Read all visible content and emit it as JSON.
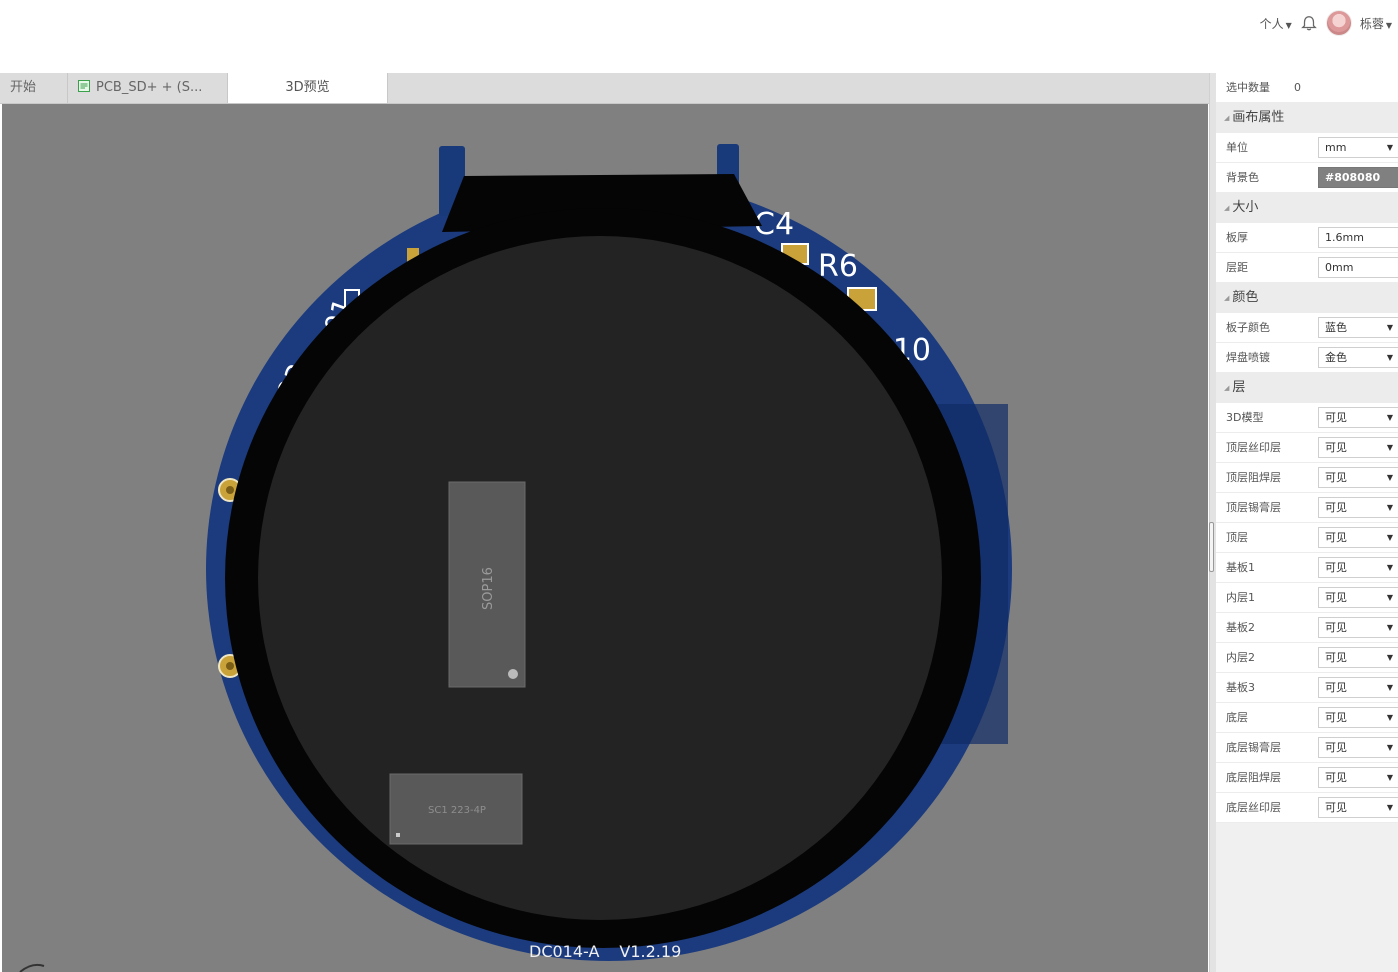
{
  "header": {
    "personal_label": "个人",
    "user_name": "栎蓉"
  },
  "tabs": [
    {
      "label": "开始"
    },
    {
      "label": "PCB_SD+ + (S..."
    },
    {
      "label": "3D预览"
    }
  ],
  "panel": {
    "selected_count_label": "选中数量",
    "selected_count": "0",
    "sections": {
      "canvas": "画布属性",
      "size": "大小",
      "color": "颜色",
      "layers": "层"
    },
    "unit_label": "单位",
    "unit_value": "mm",
    "bg_label": "背景色",
    "bg_value": "#808080",
    "thickness_label": "板厚",
    "thickness_value": "1.6mm",
    "layer_gap_label": "层距",
    "layer_gap_value": "0mm",
    "board_color_label": "板子颜色",
    "board_color_value": "蓝色",
    "pad_color_label": "焊盘喷镀",
    "pad_color_value": "金色",
    "layer_rows": [
      {
        "label": "3D模型",
        "value": "可见"
      },
      {
        "label": "顶层丝印层",
        "value": "可见"
      },
      {
        "label": "顶层阻焊层",
        "value": "可见"
      },
      {
        "label": "顶层锡膏层",
        "value": "可见"
      },
      {
        "label": "顶层",
        "value": "可见"
      },
      {
        "label": "基板1",
        "value": "可见"
      },
      {
        "label": "内层1",
        "value": "可见"
      },
      {
        "label": "基板2",
        "value": "可见"
      },
      {
        "label": "内层2",
        "value": "可见"
      },
      {
        "label": "基板3",
        "value": "可见"
      },
      {
        "label": "底层",
        "value": "可见"
      },
      {
        "label": "底层锡膏层",
        "value": "可见"
      },
      {
        "label": "底层阻焊层",
        "value": "可见"
      },
      {
        "label": "底层丝印层",
        "value": "可见"
      }
    ]
  },
  "board": {
    "silk_labels": [
      "C4",
      "R6",
      "R10",
      "01",
      "03"
    ],
    "chip_sop": "SOP16",
    "chip_sc": "SC1 223-4P",
    "footer_text": "DC014-A",
    "version_text": "V1.2.19",
    "colors": {
      "viewport_bg": "#808080",
      "board_blue": "#1a3a7c",
      "board_dark": "#0e2a60",
      "display_rim": "#050505",
      "display_face": "#232323",
      "chip": "#595959",
      "pad_gold": "#c9a23a"
    }
  }
}
